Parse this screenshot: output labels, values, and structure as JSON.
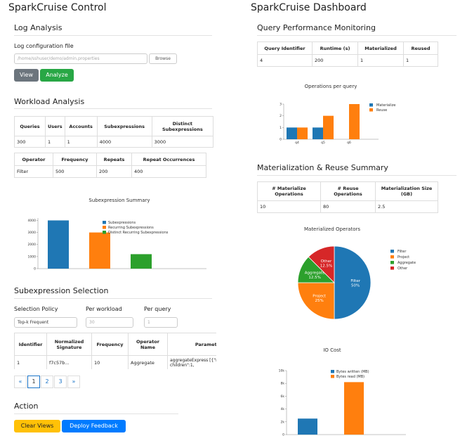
{
  "left": {
    "title": "SparkCruise Control",
    "log_analysis": {
      "heading": "Log Analysis",
      "config_label": "Log configuration file",
      "path_placeholder": "/home/sshuser/demo/admin.properties",
      "browse_label": "Browse",
      "view_label": "View",
      "analyze_label": "Analyze"
    },
    "workload": {
      "heading": "Workload Analysis",
      "summary_headers": [
        "Queries",
        "Users",
        "Accounts",
        "Subexpressions",
        "Distinct Subexpressions"
      ],
      "summary_row": [
        "300",
        "1",
        "1",
        "4000",
        "3000"
      ],
      "operator_headers": [
        "Operator",
        "Frequency",
        "Repeats",
        "Repeat Occurrences"
      ],
      "operator_row": [
        "Filter",
        "500",
        "200",
        "400"
      ]
    },
    "subexpr_selection": {
      "heading": "Subexpression Selection",
      "policy_label": "Selection Policy",
      "per_workload_label": "Per workload",
      "per_query_label": "Per query",
      "policy_value": "Top-k Frequent",
      "per_workload_placeholder": "30",
      "per_query_placeholder": "1",
      "table_headers": [
        "Identifier",
        "Normalized Signature",
        "Frequency",
        "Operator Name",
        "Parameters"
      ],
      "table_row": [
        "1",
        "f7c57b...",
        "10",
        "Aggregate",
        "aggregateExpress [{\"num-children\":1,"
      ],
      "pager": [
        "«",
        "1",
        "2",
        "3",
        "»"
      ]
    },
    "action": {
      "heading": "Action",
      "clear_label": "Clear Views",
      "deploy_label": "Deploy Feedback"
    }
  },
  "right": {
    "title": "SparkCruise Dashboard",
    "perf": {
      "heading": "Query Performance Monitoring",
      "headers": [
        "Query Identifier",
        "Runtime (s)",
        "Materialized",
        "Reused"
      ],
      "row": [
        "4",
        "200",
        "1",
        "1"
      ]
    },
    "mat_reuse": {
      "heading": "Materialization & Reuse Summary",
      "headers": [
        "# Materialize Operations",
        "# Reuse Operations",
        "Materialization Size (GB)"
      ],
      "row": [
        "10",
        "80",
        "2.5"
      ]
    }
  },
  "colors": {
    "blue": "#1f77b4",
    "orange": "#ff7f0e",
    "green": "#2ca02c",
    "red": "#d62728",
    "btn_view": "#6c757d",
    "btn_analyze": "#28a745",
    "btn_clear": "#ffc107",
    "btn_deploy": "#007bff"
  },
  "chart_data": [
    {
      "id": "subexpression-summary",
      "type": "bar",
      "title": "Subexpression Summary",
      "series": [
        {
          "name": "Subexpressions",
          "values": [
            4000
          ]
        },
        {
          "name": "Recurring Subexpressions",
          "values": [
            3000
          ]
        },
        {
          "name": "Distinct Recurring Subexpressions",
          "values": [
            1200
          ]
        }
      ],
      "yticks": [
        0,
        1000,
        2000,
        3000,
        4000
      ],
      "ylim": [
        0,
        4200
      ],
      "legend": "top-right"
    },
    {
      "id": "operations-per-query",
      "type": "bar",
      "title": "Operations per query",
      "categories": [
        "q4",
        "q5",
        "q6"
      ],
      "series": [
        {
          "name": "Materialize",
          "values": [
            1,
            1,
            0
          ]
        },
        {
          "name": "Reuse",
          "values": [
            1,
            2,
            3
          ]
        }
      ],
      "yticks": [
        0,
        1,
        2,
        3
      ],
      "ylim": [
        0,
        3
      ],
      "legend": "top-right"
    },
    {
      "id": "materialized-operators",
      "type": "pie",
      "title": "Materialized Operators",
      "slices": [
        {
          "name": "Filter",
          "value": 50,
          "label": "Filter\n50%"
        },
        {
          "name": "Project",
          "value": 25,
          "label": "Project\n25%"
        },
        {
          "name": "Aggregate",
          "value": 12.5,
          "label": "Aggregate\n12.5%"
        },
        {
          "name": "Other",
          "value": 12.5,
          "label": "Other\n12.5%"
        }
      ],
      "legend": "right"
    },
    {
      "id": "io-cost",
      "type": "bar",
      "title": "IO Cost",
      "series": [
        {
          "name": "Bytes written (MB)",
          "values": [
            2500
          ]
        },
        {
          "name": "Bytes read (MB)",
          "values": [
            8200
          ]
        }
      ],
      "yticks": [
        "0",
        "2k",
        "4k",
        "6k",
        "8k",
        "10k"
      ],
      "ylim": [
        0,
        10000
      ],
      "legend": "top-right"
    }
  ]
}
